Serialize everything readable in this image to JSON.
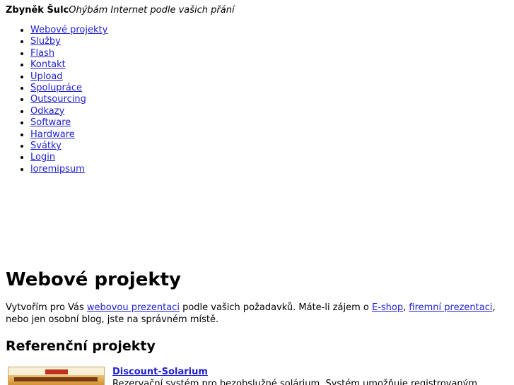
{
  "header": {
    "site_name": "Zbyněk Šulc",
    "tagline": "Ohýbám Internet podle vašich přání"
  },
  "nav": {
    "items": [
      {
        "label": "Webové projekty"
      },
      {
        "label": "Služby"
      },
      {
        "label": "Flash"
      },
      {
        "label": "Kontakt"
      },
      {
        "label": "Upload"
      },
      {
        "label": "Spolupráce"
      },
      {
        "label": "Outsourcing"
      },
      {
        "label": "Odkazy"
      },
      {
        "label": "Software"
      },
      {
        "label": "Hardware"
      },
      {
        "label": "Svátky"
      },
      {
        "label": "Login"
      },
      {
        "label": "loremipsum"
      }
    ]
  },
  "main": {
    "title": "Webové projekty",
    "intro": {
      "text_1": "Vytvořím pro Vás ",
      "link_1": "webovou prezentaci",
      "text_2": " podle vašich požadavků. Máte-li zájem o ",
      "link_2": "E-shop",
      "text_3": ", ",
      "link_3": "firemní prezentaci",
      "text_4": ", nebo jen osobní blog, jste na správném místě."
    },
    "section_title": "Referenční projekty",
    "projects": [
      {
        "name": "Discount-Solarium",
        "description": "Rezervační systém pro bezobslužné solárium. Systém umožňuje registrovaným"
      }
    ]
  },
  "colors": {
    "link": "#1f1fd3",
    "text": "#000000",
    "background": "#ffffff"
  }
}
